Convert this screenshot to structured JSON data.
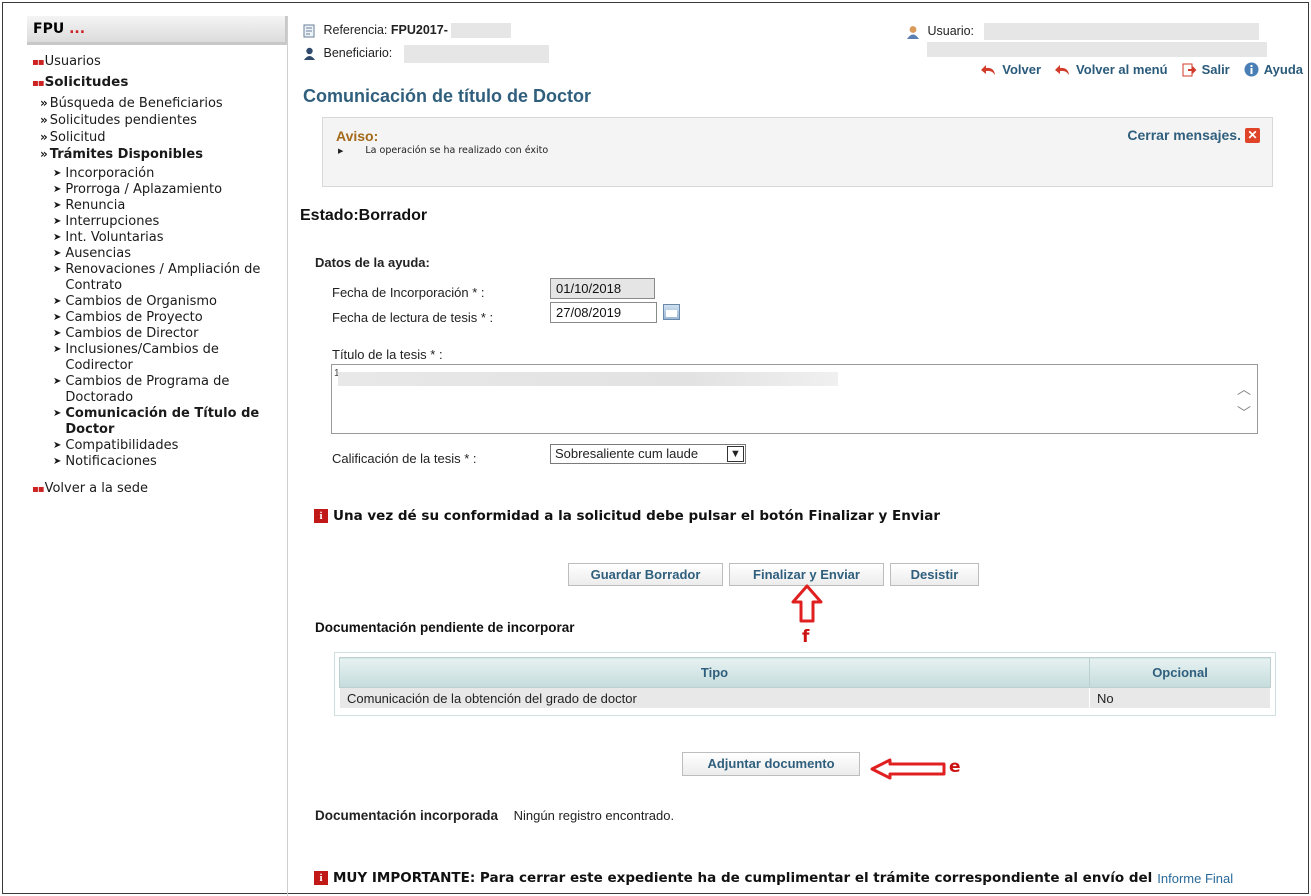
{
  "sidebar": {
    "app_title": "FPU",
    "app_title_dots": "...",
    "items": {
      "usuarios": "Usuarios",
      "solicitudes": "Solicitudes",
      "busqueda": "Búsqueda de Beneficiarios",
      "pendientes": "Solicitudes pendientes",
      "solicitud": "Solicitud",
      "tramites": "Trámites Disponibles",
      "volver_sede": "Volver a la sede"
    },
    "tramites": [
      "Incorporación",
      "Prorroga / Aplazamiento",
      "Renuncia",
      "Interrupciones",
      "Int. Voluntarias",
      "Ausencias",
      "Renovaciones / Ampliación de Contrato",
      "Cambios de Organismo",
      "Cambios de Proyecto",
      "Cambios de Director",
      "Inclusiones/Cambios de Codirector",
      "Cambios de Programa de Doctorado",
      "Comunicación de Título de Doctor",
      "Compatibilidades",
      "Notificaciones"
    ],
    "active_tramite_index": 12
  },
  "header": {
    "referencia_label": "Referencia:",
    "referencia_value": "FPU2017-",
    "beneficiario_label": "Beneficiario:",
    "usuario_label": "Usuario:",
    "links": {
      "volver": "Volver",
      "volver_menu": "Volver al menú",
      "salir": "Salir",
      "ayuda": "Ayuda"
    }
  },
  "page_title": "Comunicación de título de Doctor",
  "notice": {
    "heading": "Aviso:",
    "message": "La operación se ha realizado con éxito",
    "close_label": "Cerrar mensajes."
  },
  "estado": "Estado:Borrador",
  "form": {
    "section_title": "Datos de la ayuda:",
    "fecha_incorporacion_label": "Fecha de Incorporación * :",
    "fecha_incorporacion_value": "01/10/2018",
    "fecha_lectura_label": "Fecha de lectura de tesis * :",
    "fecha_lectura_value": "27/08/2019",
    "titulo_label": "Título de la tesis * :",
    "titulo_value": "1",
    "calificacion_label": "Calificación de la tesis * :",
    "calificacion_value": "Sobresaliente cum laude"
  },
  "warning": "Una vez dé su conformidad a la solicitud debe pulsar el botón Finalizar y Enviar",
  "buttons": {
    "guardar": "Guardar Borrador",
    "finalizar": "Finalizar y Enviar",
    "desistir": "Desistir",
    "adjuntar": "Adjuntar documento"
  },
  "annotations": {
    "f": "f",
    "e": "e",
    "color": "#e02020"
  },
  "pendiente": {
    "title": "Documentación pendiente de incorporar",
    "columns": [
      "Tipo",
      "Opcional"
    ],
    "rows": [
      [
        "Comunicación de la obtención del grado de doctor",
        "No"
      ]
    ]
  },
  "incorporada": {
    "label": "Documentación incorporada",
    "value": "Ningún registro encontrado."
  },
  "important": {
    "text": "MUY IMPORTANTE: Para cerrar este expediente ha de cumplimentar el trámite correspondiente al envío del",
    "link": "Informe Final"
  }
}
